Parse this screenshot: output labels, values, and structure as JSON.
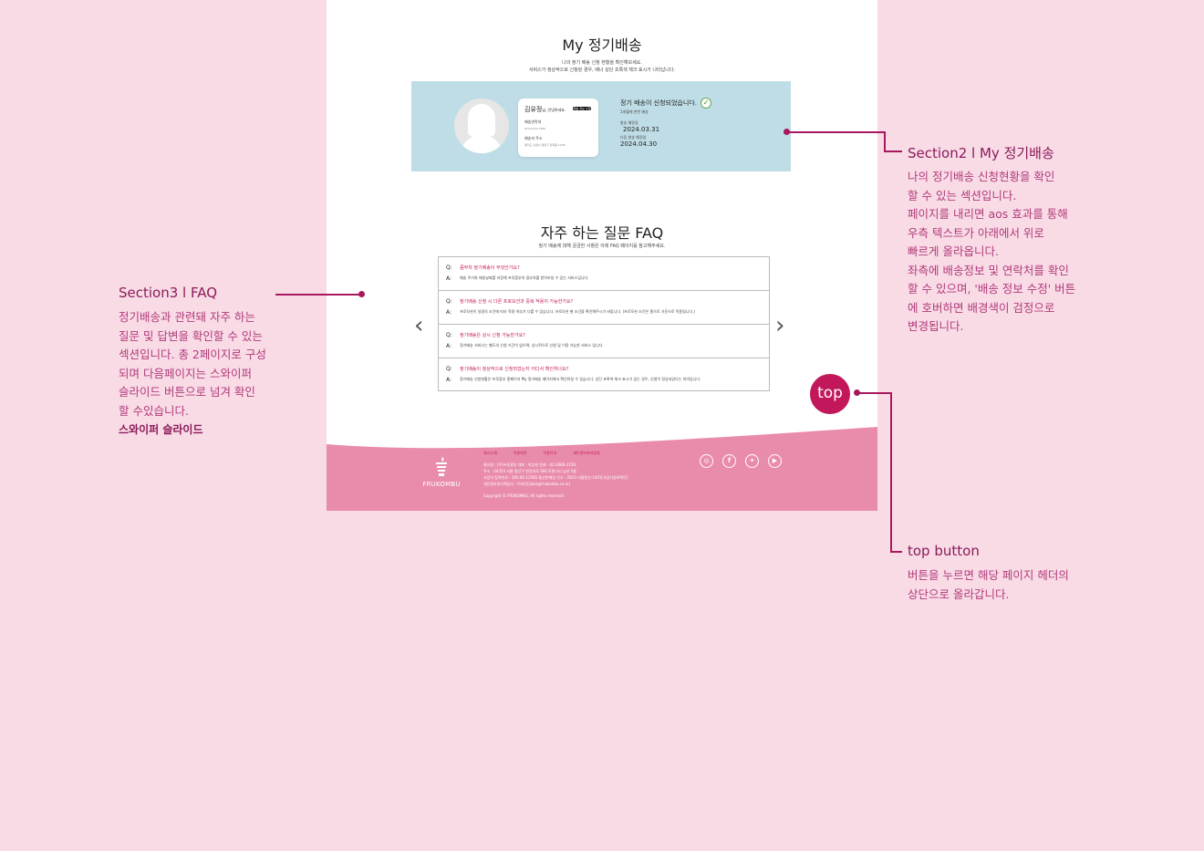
{
  "section2": {
    "title": "My 정기배송",
    "desc_line1": "나의 정기 배송 신청 현황을 확인해보세요.",
    "desc_line2": "서비스가 정상적으로 신청된 경우, 배너 상단 초록색 체크 표시가 나타납니다.",
    "card": {
      "name": "김유정",
      "name_suffix": "님, 안녕하세요.",
      "edit_label": "배송 정보 수정",
      "contact_label": "배송연락처",
      "contact_value": "010-1111-1365",
      "address_label": "배송지 주소",
      "address_value": "경기도 수원시 장안구 정자동 1234"
    },
    "status": {
      "message": "정기 배송이 신청되었습니다.",
      "cycle": "1개월에 한번 배송",
      "delivery_label": "발송 예정일",
      "delivery_date": "2024.03.31",
      "next_label": "다음 발송 예정일",
      "next_date": "2024.04.30"
    }
  },
  "faq": {
    "title": "자주 하는 질문 FAQ",
    "desc": "정기 배송에 대해 궁금한 사항은 아래 FAQ 페이지를 참고해주세요.",
    "q_marker": "Q:",
    "a_marker": "A:",
    "items": [
      {
        "q": "콤부차 정기배송이 무엇인가요?",
        "a": "매송 주기와 배송날짜를 지정해 프루콤부의 콤부차를 받아보실 수 있는 서비스입니다."
      },
      {
        "q": "정기배송 신청 시 다른 프로모션과 중복 적용이 가능한가요?",
        "a": "프로모션이 일정의 조건에 따라 적용 여부가 다를 수 있습니다. 프로모션 별 조건을 확인해주시기 바랍니다. (프로모션 조건은 홈으로 기준으로 적용됩니다.)"
      },
      {
        "q": "정기배송은 상시 신청 가능한가요?",
        "a": "정기배송 서비스는 별도의 신청 기간이 없으며, 상시적으로 신청 및 이용 가능한 서비스 입니다."
      },
      {
        "q": "정기배송이 정상적으로 신청되었는지 어디서 확인하나요?",
        "a": "정기배송 신청현황은 프루콤부 홈페이지 My 정기배송 페이지에서 확인하실 수 있습니다. 상단 초록색 체크 표시가 있는 경우, 신청이 정상되었다는 의미입니다."
      }
    ],
    "prev_arrow": "‹",
    "next_arrow": "›"
  },
  "top_button": {
    "label": "top"
  },
  "footer": {
    "brand": "FRUKOMBU",
    "links": [
      "회사소개",
      "이용약관",
      "이용안내",
      "개인정보처리방침"
    ],
    "info": [
      "회사명 : (주)프루콤부     대표 : 박승현     전화 : 02-2680-2158",
      "주소 : 04323 서울 용산구 한강대로 366 트윈시티 남산 5층",
      "사업자 등록번호 : 305-85-12585     통신판매업 신고 : 2023-서울용산-1401[사업자정보확인]",
      "개인정보관리책임자 : 이지민(jiabo@frukombu.co.kr)"
    ],
    "copyright": "Copyright © FRUKOMBU. All rights reserved.",
    "sns": {
      "instagram": "instagram-icon",
      "facebook": "facebook-icon",
      "twitter": "twitter-icon",
      "youtube": "youtube-icon"
    },
    "color_top": "#e88fa9",
    "color_bottom": "#e98cab"
  },
  "annotations": {
    "section2": {
      "title": "Section2 l My 정기배송",
      "lines": [
        "나의 정기배송 신청현황을 확인",
        "할 수 있는 섹션입니다.",
        "페이지를 내리면 aos 효과를 통해",
        "우측 텍스트가 아래에서 위로",
        "빠르게 올라옵니다.",
        "좌측에 배송정보 및 연락처를 확인",
        "할 수 있으며, '배송 정보 수정' 버튼",
        "에 호버하면 배경색이 검정으로",
        "변경됩니다."
      ]
    },
    "section3": {
      "title": "Section3 l FAQ",
      "lines": [
        "정기배송과 관련돼 자주 하는",
        "질문 및 답변을 확인할 수 있는",
        "섹션입니다. 총 2페이지로 구성",
        "되며 다음페이지는 스와이퍼",
        "슬라이드 버튼으로 넘겨 확인",
        "할 수있습니다."
      ],
      "tag": "스와이퍼 슬라이드"
    },
    "top": {
      "title": "top button",
      "lines": [
        "버튼을 누르면 해당 페이지 헤더의",
        "상단으로 올라갑니다."
      ]
    }
  },
  "colors": {
    "background": "#f9dbe6",
    "accent": "#c2185b",
    "annotation": "#a8185f",
    "banner": "#bfdde6"
  }
}
